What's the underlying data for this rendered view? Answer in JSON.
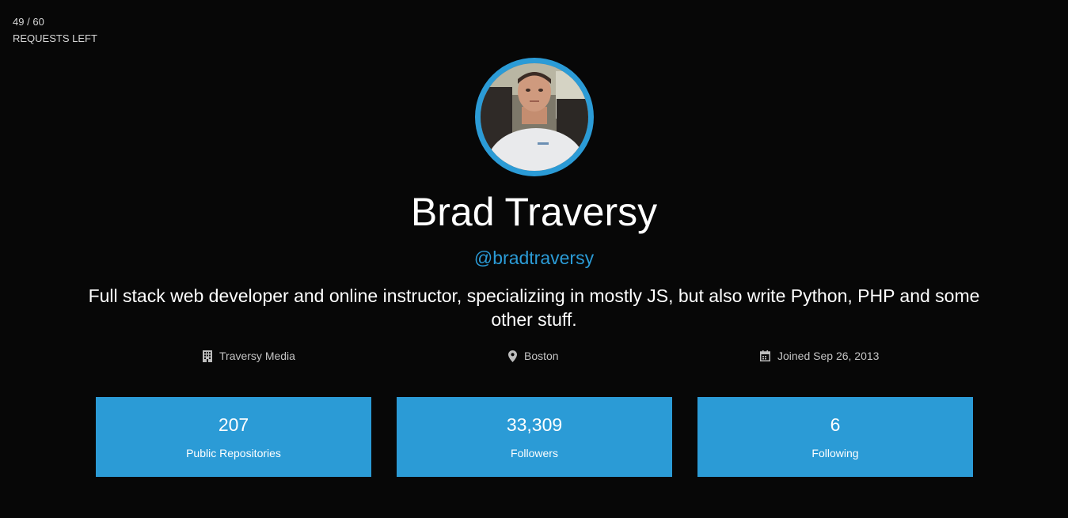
{
  "rate_limit": {
    "remaining": "49",
    "separator": "/",
    "limit": "60",
    "label": "REQUESTS LEFT"
  },
  "profile": {
    "avatar_icon": "avatar-photo",
    "name": "Brad Traversy",
    "login": "@bradtraversy",
    "bio": "Full stack web developer and online instructor, specializiing in mostly JS, but also write Python, PHP and some other stuff."
  },
  "meta": {
    "company": {
      "icon": "building-icon",
      "text": "Traversy Media"
    },
    "location": {
      "icon": "map-pin-icon",
      "text": "Boston"
    },
    "joined": {
      "icon": "calendar-icon",
      "text": "Joined Sep 26, 2013"
    }
  },
  "stats": [
    {
      "value": "207",
      "label": "Public Repositories"
    },
    {
      "value": "33,309",
      "label": "Followers"
    },
    {
      "value": "6",
      "label": "Following"
    }
  ],
  "colors": {
    "background": "#070707",
    "accent": "#2b9bd6",
    "text": "#ffffff",
    "muted": "#c4c4c4"
  }
}
